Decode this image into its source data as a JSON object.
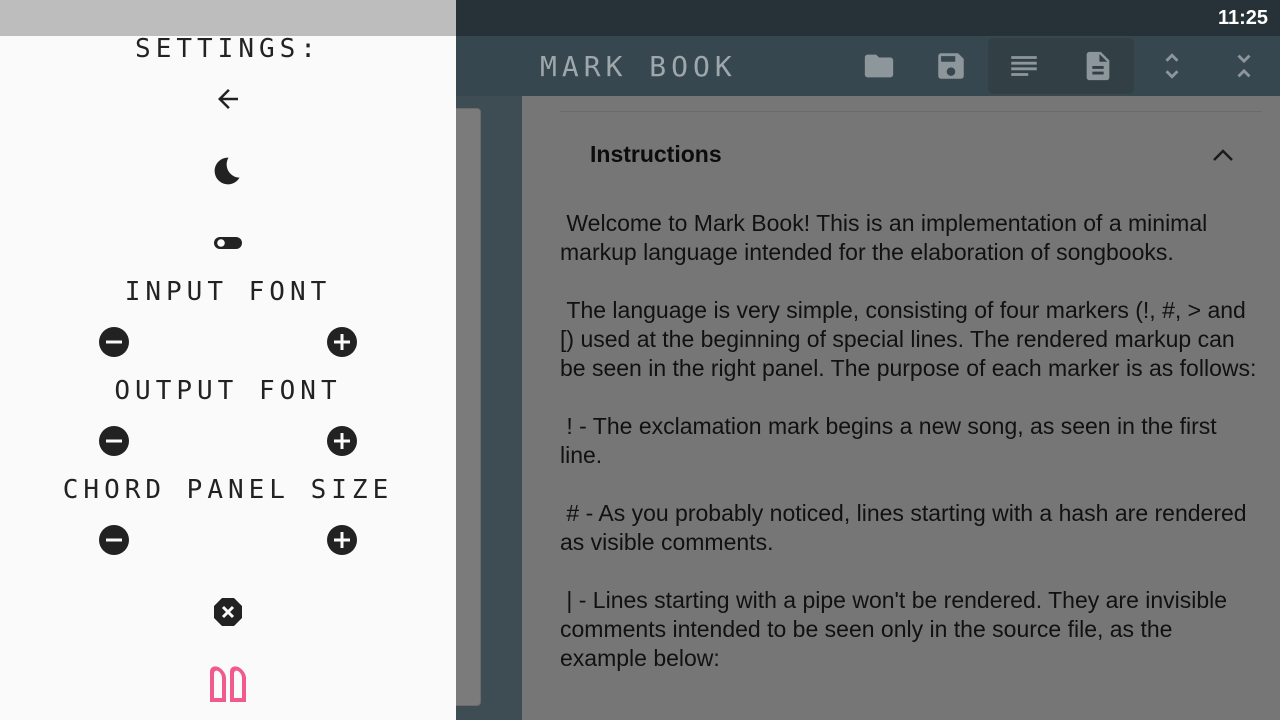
{
  "status_bar": {
    "time": "11:25"
  },
  "app": {
    "title": "MARK BOOK"
  },
  "toolbar": {
    "buttons": [
      {
        "name": "open-folder",
        "icon": "folder-icon"
      },
      {
        "name": "save",
        "icon": "save-icon"
      },
      {
        "name": "source-view",
        "icon": "lines-icon"
      },
      {
        "name": "rendered-view",
        "icon": "document-icon"
      },
      {
        "name": "expand",
        "icon": "unfold-more-icon"
      },
      {
        "name": "collapse",
        "icon": "unfold-less-icon"
      }
    ]
  },
  "settings": {
    "title": "SETTINGS:",
    "back_icon": "arrow-back-icon",
    "theme_icon": "moon-icon",
    "toggle_icon": "toggle-icon",
    "input_font_label": "INPUT FONT",
    "output_font_label": "OUTPUT FONT",
    "chord_panel_label": "CHORD PANEL SIZE",
    "close_icon": "close-octagon-icon",
    "logo_icon": "mark-book-logo-icon",
    "logo_color": "#f05a8c"
  },
  "instructions": {
    "title": "Instructions",
    "body": " Welcome to Mark Book! This is an implementation of a minimal markup language intended for the elaboration of songbooks.\n\n The language is very simple, consisting of four markers (!, #, > and [) used at the beginning of special lines. The rendered markup can be seen in the right panel. The purpose of each marker is as follows:\n\n ! - The exclamation mark begins a new song, as seen in the first line.\n\n # - As you probably noticed, lines starting with a hash are rendered as visible comments.\n\n | - Lines starting with a pipe won't be rendered. They are invisible comments intended to be seen only in the source file, as the example below:"
  },
  "colors": {
    "status_bar": "#263238",
    "app_bar": "#37474f",
    "drawer": "#fafafa",
    "dim_content": "#767676"
  }
}
